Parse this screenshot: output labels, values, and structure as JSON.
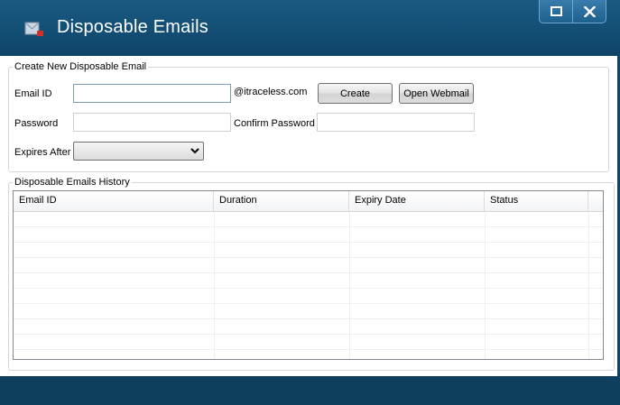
{
  "window": {
    "title": "Disposable Emails",
    "icon": "envelope-app-icon"
  },
  "create_group": {
    "legend": "Create New Disposable Email",
    "email_label": "Email ID",
    "email_value": "",
    "domain_suffix": "@itraceless.com",
    "create_button": "Create",
    "open_webmail_button": "Open Webmail",
    "password_label": "Password",
    "password_value": "",
    "confirm_password_label": "Confirm Password",
    "confirm_password_value": "",
    "expires_label": "Expires After",
    "expires_selected": ""
  },
  "history_group": {
    "legend": "Disposable Emails History",
    "columns": [
      "Email ID",
      "Duration",
      "Expiry Date",
      "Status"
    ],
    "rows": []
  }
}
